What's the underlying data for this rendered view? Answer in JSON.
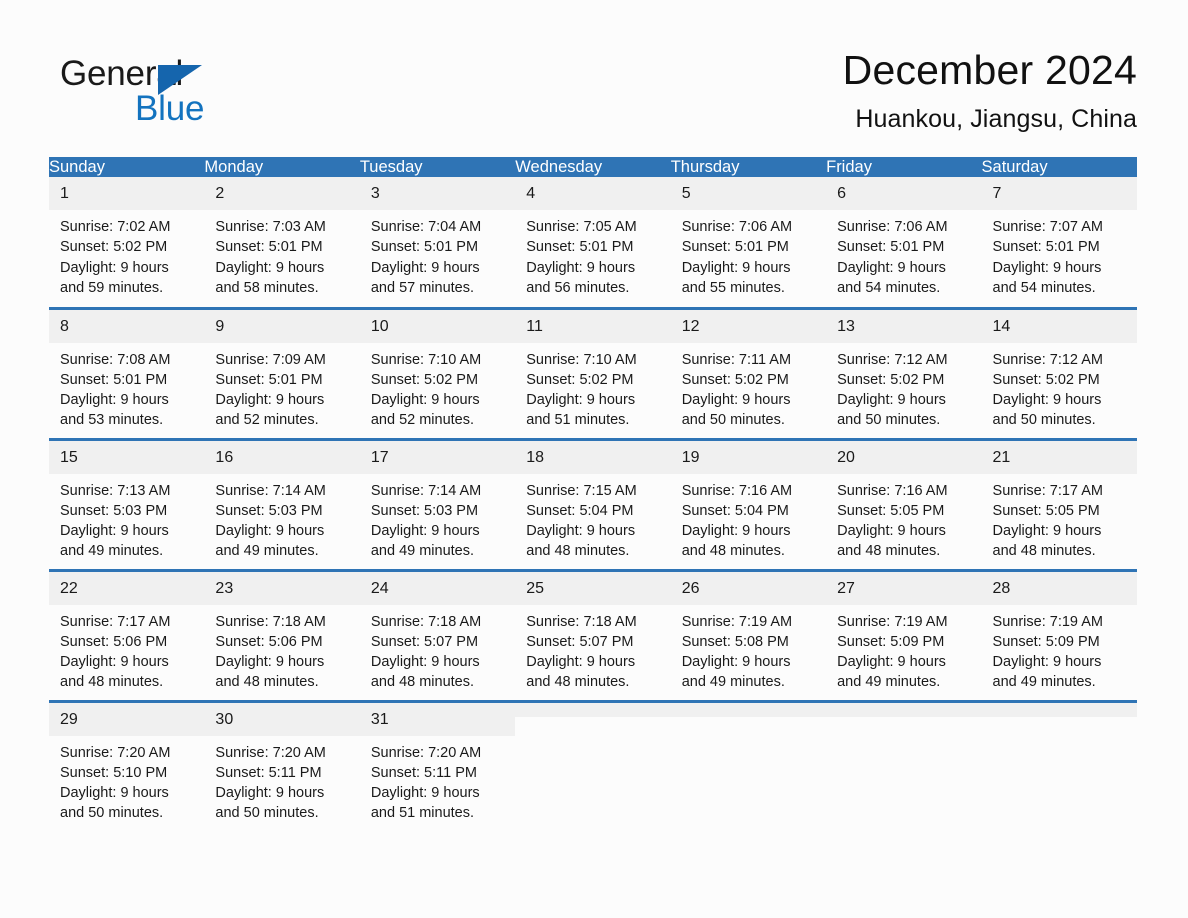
{
  "brand": {
    "word_one": "General",
    "word_two": "Blue",
    "triangle_color": "#1565ad",
    "blue_color": "#1373bf"
  },
  "header": {
    "title": "December 2024",
    "subtitle": "Huankou, Jiangsu, China"
  },
  "theme": {
    "header_bg": "#2f74b5",
    "header_text": "#ffffff",
    "daynum_bg": "#f0f0f0",
    "page_bg": "#fcfcfc",
    "separator": "#2f74b5"
  },
  "weekday_headers": [
    "Sunday",
    "Monday",
    "Tuesday",
    "Wednesday",
    "Thursday",
    "Friday",
    "Saturday"
  ],
  "weeks": [
    [
      {
        "day": "1",
        "sunrise": "Sunrise: 7:02 AM",
        "sunset": "Sunset: 5:02 PM",
        "daylight_line1": "Daylight: 9 hours",
        "daylight_line2": "and 59 minutes."
      },
      {
        "day": "2",
        "sunrise": "Sunrise: 7:03 AM",
        "sunset": "Sunset: 5:01 PM",
        "daylight_line1": "Daylight: 9 hours",
        "daylight_line2": "and 58 minutes."
      },
      {
        "day": "3",
        "sunrise": "Sunrise: 7:04 AM",
        "sunset": "Sunset: 5:01 PM",
        "daylight_line1": "Daylight: 9 hours",
        "daylight_line2": "and 57 minutes."
      },
      {
        "day": "4",
        "sunrise": "Sunrise: 7:05 AM",
        "sunset": "Sunset: 5:01 PM",
        "daylight_line1": "Daylight: 9 hours",
        "daylight_line2": "and 56 minutes."
      },
      {
        "day": "5",
        "sunrise": "Sunrise: 7:06 AM",
        "sunset": "Sunset: 5:01 PM",
        "daylight_line1": "Daylight: 9 hours",
        "daylight_line2": "and 55 minutes."
      },
      {
        "day": "6",
        "sunrise": "Sunrise: 7:06 AM",
        "sunset": "Sunset: 5:01 PM",
        "daylight_line1": "Daylight: 9 hours",
        "daylight_line2": "and 54 minutes."
      },
      {
        "day": "7",
        "sunrise": "Sunrise: 7:07 AM",
        "sunset": "Sunset: 5:01 PM",
        "daylight_line1": "Daylight: 9 hours",
        "daylight_line2": "and 54 minutes."
      }
    ],
    [
      {
        "day": "8",
        "sunrise": "Sunrise: 7:08 AM",
        "sunset": "Sunset: 5:01 PM",
        "daylight_line1": "Daylight: 9 hours",
        "daylight_line2": "and 53 minutes."
      },
      {
        "day": "9",
        "sunrise": "Sunrise: 7:09 AM",
        "sunset": "Sunset: 5:01 PM",
        "daylight_line1": "Daylight: 9 hours",
        "daylight_line2": "and 52 minutes."
      },
      {
        "day": "10",
        "sunrise": "Sunrise: 7:10 AM",
        "sunset": "Sunset: 5:02 PM",
        "daylight_line1": "Daylight: 9 hours",
        "daylight_line2": "and 52 minutes."
      },
      {
        "day": "11",
        "sunrise": "Sunrise: 7:10 AM",
        "sunset": "Sunset: 5:02 PM",
        "daylight_line1": "Daylight: 9 hours",
        "daylight_line2": "and 51 minutes."
      },
      {
        "day": "12",
        "sunrise": "Sunrise: 7:11 AM",
        "sunset": "Sunset: 5:02 PM",
        "daylight_line1": "Daylight: 9 hours",
        "daylight_line2": "and 50 minutes."
      },
      {
        "day": "13",
        "sunrise": "Sunrise: 7:12 AM",
        "sunset": "Sunset: 5:02 PM",
        "daylight_line1": "Daylight: 9 hours",
        "daylight_line2": "and 50 minutes."
      },
      {
        "day": "14",
        "sunrise": "Sunrise: 7:12 AM",
        "sunset": "Sunset: 5:02 PM",
        "daylight_line1": "Daylight: 9 hours",
        "daylight_line2": "and 50 minutes."
      }
    ],
    [
      {
        "day": "15",
        "sunrise": "Sunrise: 7:13 AM",
        "sunset": "Sunset: 5:03 PM",
        "daylight_line1": "Daylight: 9 hours",
        "daylight_line2": "and 49 minutes."
      },
      {
        "day": "16",
        "sunrise": "Sunrise: 7:14 AM",
        "sunset": "Sunset: 5:03 PM",
        "daylight_line1": "Daylight: 9 hours",
        "daylight_line2": "and 49 minutes."
      },
      {
        "day": "17",
        "sunrise": "Sunrise: 7:14 AM",
        "sunset": "Sunset: 5:03 PM",
        "daylight_line1": "Daylight: 9 hours",
        "daylight_line2": "and 49 minutes."
      },
      {
        "day": "18",
        "sunrise": "Sunrise: 7:15 AM",
        "sunset": "Sunset: 5:04 PM",
        "daylight_line1": "Daylight: 9 hours",
        "daylight_line2": "and 48 minutes."
      },
      {
        "day": "19",
        "sunrise": "Sunrise: 7:16 AM",
        "sunset": "Sunset: 5:04 PM",
        "daylight_line1": "Daylight: 9 hours",
        "daylight_line2": "and 48 minutes."
      },
      {
        "day": "20",
        "sunrise": "Sunrise: 7:16 AM",
        "sunset": "Sunset: 5:05 PM",
        "daylight_line1": "Daylight: 9 hours",
        "daylight_line2": "and 48 minutes."
      },
      {
        "day": "21",
        "sunrise": "Sunrise: 7:17 AM",
        "sunset": "Sunset: 5:05 PM",
        "daylight_line1": "Daylight: 9 hours",
        "daylight_line2": "and 48 minutes."
      }
    ],
    [
      {
        "day": "22",
        "sunrise": "Sunrise: 7:17 AM",
        "sunset": "Sunset: 5:06 PM",
        "daylight_line1": "Daylight: 9 hours",
        "daylight_line2": "and 48 minutes."
      },
      {
        "day": "23",
        "sunrise": "Sunrise: 7:18 AM",
        "sunset": "Sunset: 5:06 PM",
        "daylight_line1": "Daylight: 9 hours",
        "daylight_line2": "and 48 minutes."
      },
      {
        "day": "24",
        "sunrise": "Sunrise: 7:18 AM",
        "sunset": "Sunset: 5:07 PM",
        "daylight_line1": "Daylight: 9 hours",
        "daylight_line2": "and 48 minutes."
      },
      {
        "day": "25",
        "sunrise": "Sunrise: 7:18 AM",
        "sunset": "Sunset: 5:07 PM",
        "daylight_line1": "Daylight: 9 hours",
        "daylight_line2": "and 48 minutes."
      },
      {
        "day": "26",
        "sunrise": "Sunrise: 7:19 AM",
        "sunset": "Sunset: 5:08 PM",
        "daylight_line1": "Daylight: 9 hours",
        "daylight_line2": "and 49 minutes."
      },
      {
        "day": "27",
        "sunrise": "Sunrise: 7:19 AM",
        "sunset": "Sunset: 5:09 PM",
        "daylight_line1": "Daylight: 9 hours",
        "daylight_line2": "and 49 minutes."
      },
      {
        "day": "28",
        "sunrise": "Sunrise: 7:19 AM",
        "sunset": "Sunset: 5:09 PM",
        "daylight_line1": "Daylight: 9 hours",
        "daylight_line2": "and 49 minutes."
      }
    ],
    [
      {
        "day": "29",
        "sunrise": "Sunrise: 7:20 AM",
        "sunset": "Sunset: 5:10 PM",
        "daylight_line1": "Daylight: 9 hours",
        "daylight_line2": "and 50 minutes."
      },
      {
        "day": "30",
        "sunrise": "Sunrise: 7:20 AM",
        "sunset": "Sunset: 5:11 PM",
        "daylight_line1": "Daylight: 9 hours",
        "daylight_line2": "and 50 minutes."
      },
      {
        "day": "31",
        "sunrise": "Sunrise: 7:20 AM",
        "sunset": "Sunset: 5:11 PM",
        "daylight_line1": "Daylight: 9 hours",
        "daylight_line2": "and 51 minutes."
      },
      {
        "day": "",
        "sunrise": "",
        "sunset": "",
        "daylight_line1": "",
        "daylight_line2": ""
      },
      {
        "day": "",
        "sunrise": "",
        "sunset": "",
        "daylight_line1": "",
        "daylight_line2": ""
      },
      {
        "day": "",
        "sunrise": "",
        "sunset": "",
        "daylight_line1": "",
        "daylight_line2": ""
      },
      {
        "day": "",
        "sunrise": "",
        "sunset": "",
        "daylight_line1": "",
        "daylight_line2": ""
      }
    ]
  ]
}
